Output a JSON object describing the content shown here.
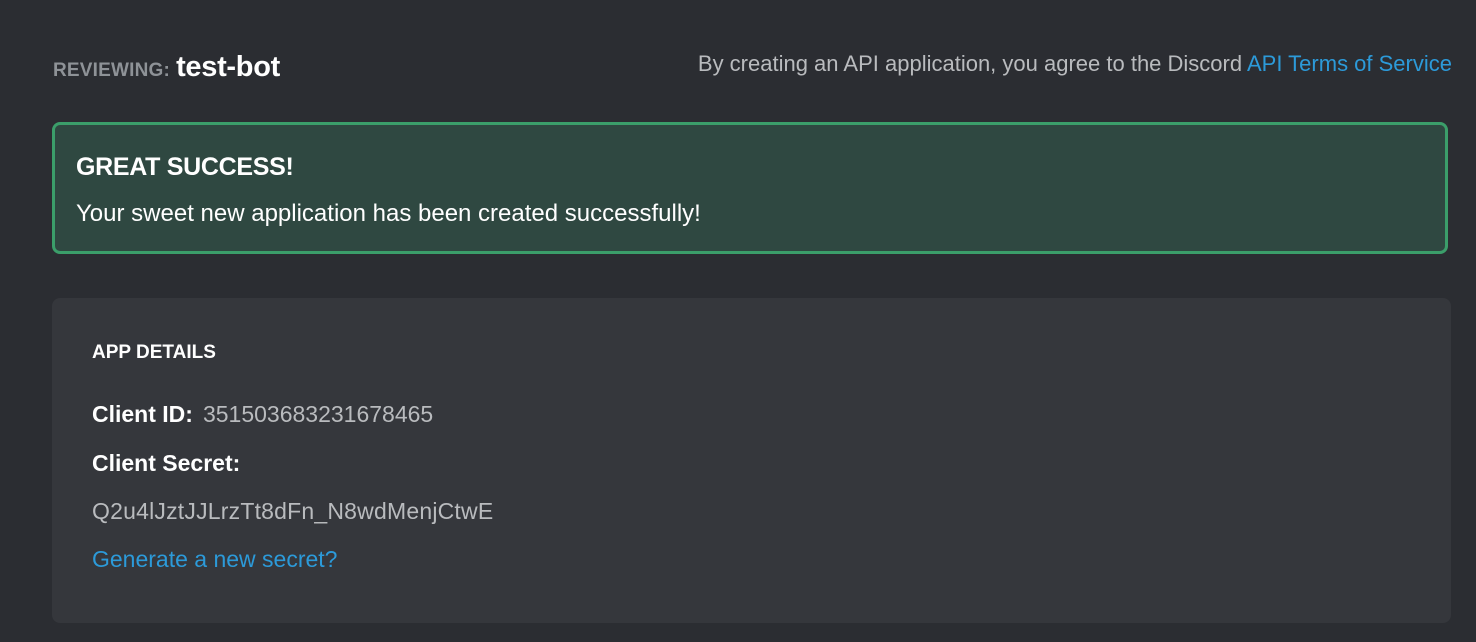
{
  "header": {
    "reviewing_label": "REVIEWING:",
    "app_name": "test-bot",
    "tos_text": "By creating an API application, you agree to the Discord ",
    "tos_link": "API Terms of Service"
  },
  "alert": {
    "title": "GREAT SUCCESS!",
    "message": "Your sweet new application has been created successfully!"
  },
  "app_details": {
    "title": "APP DETAILS",
    "client_id_label": "Client ID:",
    "client_id": "351503683231678465",
    "client_secret_label": "Client Secret:",
    "client_secret": "Q2u4lJztJJLrzTt8dFn_N8wdMenjCtwE",
    "regenerate_link": "Generate a new secret?"
  },
  "colors": {
    "background": "#2b2d32",
    "panel": "#35373c",
    "success_border": "#3b9e6a",
    "success_background": "#2f4841",
    "link": "#2c9ad9",
    "muted_text": "#b9bbbe"
  }
}
